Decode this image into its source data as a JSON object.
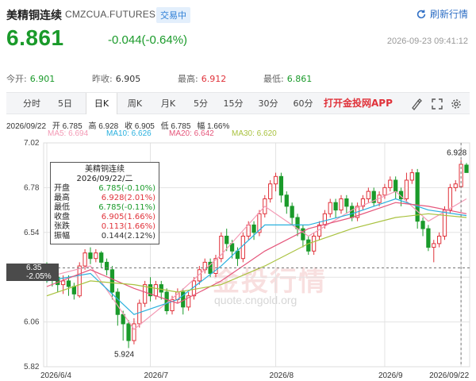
{
  "header": {
    "name": "美精铜连续",
    "code": "CMZCUA.FUTURES",
    "status": "交易中",
    "refresh_label": "刷新行情"
  },
  "quote": {
    "price": "6.861",
    "change": "-0.044(-0.64%)",
    "time": "2026-09-23 09:41:12"
  },
  "stats": [
    {
      "label": "今开:",
      "value": "6.901",
      "tone": "green"
    },
    {
      "label": "昨收:",
      "value": "6.905",
      "tone": "dark"
    },
    {
      "label": "最高:",
      "value": "6.912",
      "tone": "red"
    },
    {
      "label": "最低:",
      "value": "6.861",
      "tone": "green"
    }
  ],
  "tabs": [
    "分时",
    "5日",
    "日K",
    "周K",
    "月K",
    "5分",
    "15分",
    "30分",
    "60分"
  ],
  "active_tab": "日K",
  "promo": "打开金投网APP",
  "icons": {
    "brush": "brush-icon",
    "fullscreen": "fullscreen-icon",
    "settings": "settings-icon"
  },
  "info_line": {
    "date": "2026/09/22",
    "open": "开 6.785",
    "high": "高 6.928",
    "close": "收 6.905",
    "low": "低 6.785",
    "amp": "幅 1.66%"
  },
  "ma_legend": [
    {
      "label": "MA5: 6.694",
      "color": "#f39ab5"
    },
    {
      "label": "MA10: 6.626",
      "color": "#2ab0de"
    },
    {
      "label": "MA20: 6.642",
      "color": "#e5567b"
    },
    {
      "label": "MA30: 6.620",
      "color": "#a9c23f"
    }
  ],
  "tooltip": {
    "title": "美精铜连续",
    "date": "2026/09/22/二",
    "rows": [
      {
        "label": "开盘",
        "value": "6.785(-0.10%)",
        "tone": "green"
      },
      {
        "label": "最高",
        "value": "6.928(2.01%)",
        "tone": "red"
      },
      {
        "label": "最低",
        "value": "6.785(-0.11%)",
        "tone": "green"
      },
      {
        "label": "收盘",
        "value": "6.905(1.66%)",
        "tone": "red"
      },
      {
        "label": "张跌",
        "value": "0.113(1.66%)",
        "tone": "red"
      },
      {
        "label": "振幅",
        "value": "0.144(2.12%)",
        "tone": "dark"
      }
    ]
  },
  "crosshair": {
    "price": "6.35",
    "pct": "-2.05%"
  },
  "watermark": {
    "cn": "金投行情",
    "url": "quote.cngold.org"
  },
  "colors": {
    "up": "#e0323a",
    "down": "#1a9a2a",
    "grid": "#e3e3e3"
  },
  "chart_data": {
    "type": "candlestick",
    "y_ticks": [
      "7.02",
      "6.78",
      "6.54",
      "6.30",
      "6.06",
      "5.82"
    ],
    "ylim": [
      5.82,
      7.02
    ],
    "x_labels": [
      {
        "label": "2026/6/4",
        "index": 0
      },
      {
        "label": "2026/7",
        "index": 19
      },
      {
        "label": "2026/8",
        "index": 42
      },
      {
        "label": "2026/9",
        "index": 62
      },
      {
        "label": "2026/09/22",
        "index": 76
      }
    ],
    "annotations": [
      {
        "label": "6.928",
        "index": 76,
        "value": 6.928
      },
      {
        "label": "5.924",
        "index": 15,
        "value": 5.924
      }
    ],
    "candles": [
      [
        6.35,
        6.33,
        6.38,
        6.27
      ],
      [
        6.33,
        6.3,
        6.36,
        6.25
      ],
      [
        6.3,
        6.26,
        6.33,
        6.22
      ],
      [
        6.26,
        6.28,
        6.31,
        6.21
      ],
      [
        6.28,
        6.25,
        6.31,
        6.2
      ],
      [
        6.25,
        6.21,
        6.27,
        6.18
      ],
      [
        6.2,
        6.36,
        6.38,
        6.19
      ],
      [
        6.36,
        6.43,
        6.45,
        6.34
      ],
      [
        6.43,
        6.4,
        6.46,
        6.37
      ],
      [
        6.4,
        6.43,
        6.45,
        6.38
      ],
      [
        6.43,
        6.38,
        6.44,
        6.35
      ],
      [
        6.38,
        6.34,
        6.4,
        6.31
      ],
      [
        6.34,
        6.22,
        6.36,
        6.18
      ],
      [
        6.22,
        6.1,
        6.24,
        6.04
      ],
      [
        6.1,
        6.05,
        6.12,
        5.96
      ],
      [
        6.05,
        5.96,
        6.07,
        5.92
      ],
      [
        5.96,
        6.05,
        6.08,
        5.94
      ],
      [
        6.05,
        6.16,
        6.18,
        6.03
      ],
      [
        6.16,
        6.26,
        6.28,
        6.14
      ],
      [
        6.26,
        6.2,
        6.3,
        6.17
      ],
      [
        6.2,
        6.26,
        6.28,
        6.18
      ],
      [
        6.26,
        6.22,
        6.28,
        6.18
      ],
      [
        6.22,
        6.12,
        6.24,
        6.1
      ],
      [
        6.12,
        6.18,
        6.2,
        6.1
      ],
      [
        6.18,
        6.22,
        6.24,
        6.16
      ],
      [
        6.22,
        6.14,
        6.24,
        6.1
      ],
      [
        6.14,
        6.2,
        6.22,
        6.12
      ],
      [
        6.2,
        6.28,
        6.3,
        6.18
      ],
      [
        6.28,
        6.34,
        6.36,
        6.26
      ],
      [
        6.34,
        6.38,
        6.4,
        6.32
      ],
      [
        6.38,
        6.32,
        6.4,
        6.3
      ],
      [
        6.32,
        6.4,
        6.42,
        6.3
      ],
      [
        6.4,
        6.52,
        6.54,
        6.38
      ],
      [
        6.52,
        6.48,
        6.56,
        6.44
      ],
      [
        6.48,
        6.44,
        6.5,
        6.4
      ],
      [
        6.44,
        6.4,
        6.46,
        6.36
      ],
      [
        6.4,
        6.52,
        6.54,
        6.38
      ],
      [
        6.52,
        6.58,
        6.6,
        6.5
      ],
      [
        6.58,
        6.54,
        6.6,
        6.5
      ],
      [
        6.54,
        6.64,
        6.66,
        6.52
      ],
      [
        6.64,
        6.72,
        6.74,
        6.62
      ],
      [
        6.72,
        6.8,
        6.82,
        6.7
      ],
      [
        6.8,
        6.84,
        6.86,
        6.76
      ],
      [
        6.84,
        6.74,
        6.86,
        6.7
      ],
      [
        6.74,
        6.68,
        6.76,
        6.64
      ],
      [
        6.68,
        6.62,
        6.7,
        6.58
      ],
      [
        6.62,
        6.56,
        6.64,
        6.52
      ],
      [
        6.56,
        6.5,
        6.58,
        6.46
      ],
      [
        6.5,
        6.44,
        6.52,
        6.42
      ],
      [
        6.44,
        6.52,
        6.54,
        6.42
      ],
      [
        6.52,
        6.58,
        6.6,
        6.5
      ],
      [
        6.58,
        6.64,
        6.66,
        6.56
      ],
      [
        6.64,
        6.7,
        6.72,
        6.62
      ],
      [
        6.7,
        6.66,
        6.72,
        6.62
      ],
      [
        6.66,
        6.72,
        6.74,
        6.64
      ],
      [
        6.72,
        6.68,
        6.74,
        6.64
      ],
      [
        6.68,
        6.62,
        6.7,
        6.6
      ],
      [
        6.62,
        6.68,
        6.7,
        6.6
      ],
      [
        6.68,
        6.72,
        6.74,
        6.66
      ],
      [
        6.72,
        6.76,
        6.78,
        6.7
      ],
      [
        6.76,
        6.7,
        6.78,
        6.68
      ],
      [
        6.7,
        6.74,
        6.76,
        6.68
      ],
      [
        6.74,
        6.78,
        6.8,
        6.72
      ],
      [
        6.78,
        6.82,
        6.84,
        6.76
      ],
      [
        6.82,
        6.76,
        6.84,
        6.72
      ],
      [
        6.76,
        6.72,
        6.78,
        6.68
      ],
      [
        6.72,
        6.82,
        6.86,
        6.7
      ],
      [
        6.82,
        6.86,
        6.88,
        6.8
      ],
      [
        6.86,
        6.6,
        6.88,
        6.56
      ],
      [
        6.6,
        6.56,
        6.62,
        6.52
      ],
      [
        6.56,
        6.46,
        6.58,
        6.44
      ],
      [
        6.46,
        6.48,
        6.5,
        6.38
      ],
      [
        6.48,
        6.52,
        6.54,
        6.46
      ],
      [
        6.52,
        6.66,
        6.68,
        6.5
      ],
      [
        6.66,
        6.78,
        6.8,
        6.64
      ],
      [
        6.78,
        6.8,
        6.82,
        6.76
      ],
      [
        6.785,
        6.905,
        6.928,
        6.785
      ],
      [
        6.901,
        6.861,
        6.912,
        6.861
      ]
    ],
    "ma_series": [
      {
        "key": "MA5",
        "values": [
          [
            0,
            6.3
          ],
          [
            8,
            6.36
          ],
          [
            16,
            6.02
          ],
          [
            24,
            6.21
          ],
          [
            32,
            6.42
          ],
          [
            40,
            6.68
          ],
          [
            48,
            6.52
          ],
          [
            56,
            6.66
          ],
          [
            64,
            6.76
          ],
          [
            70,
            6.6
          ],
          [
            77,
            6.72
          ]
        ]
      },
      {
        "key": "MA10",
        "values": [
          [
            0,
            6.28
          ],
          [
            8,
            6.32
          ],
          [
            16,
            6.1
          ],
          [
            24,
            6.18
          ],
          [
            32,
            6.36
          ],
          [
            40,
            6.58
          ],
          [
            48,
            6.58
          ],
          [
            56,
            6.64
          ],
          [
            64,
            6.72
          ],
          [
            70,
            6.66
          ],
          [
            77,
            6.63
          ]
        ]
      },
      {
        "key": "MA20",
        "values": [
          [
            0,
            6.25
          ],
          [
            8,
            6.34
          ],
          [
            16,
            6.24
          ],
          [
            24,
            6.16
          ],
          [
            32,
            6.28
          ],
          [
            40,
            6.44
          ],
          [
            48,
            6.56
          ],
          [
            56,
            6.62
          ],
          [
            64,
            6.7
          ],
          [
            70,
            6.68
          ],
          [
            77,
            6.64
          ]
        ]
      },
      {
        "key": "MA30",
        "values": [
          [
            0,
            6.2
          ],
          [
            8,
            6.28
          ],
          [
            16,
            6.26
          ],
          [
            24,
            6.22
          ],
          [
            32,
            6.26
          ],
          [
            40,
            6.36
          ],
          [
            48,
            6.48
          ],
          [
            56,
            6.56
          ],
          [
            64,
            6.62
          ],
          [
            70,
            6.64
          ],
          [
            77,
            6.62
          ]
        ]
      }
    ]
  }
}
